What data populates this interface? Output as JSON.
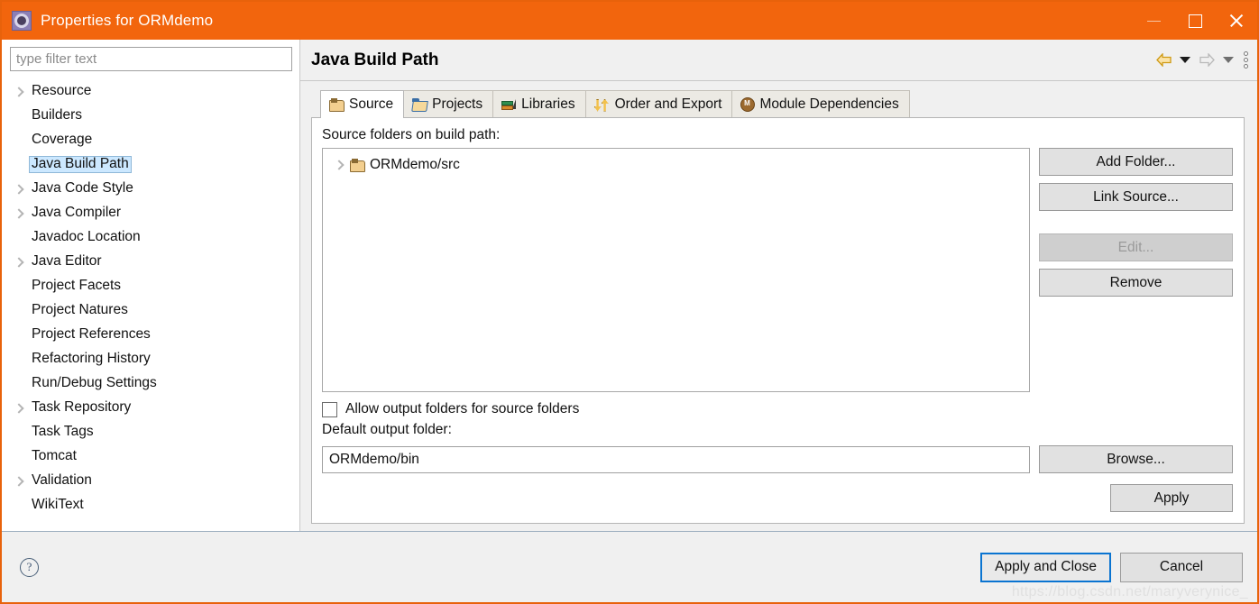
{
  "window": {
    "title": "Properties for ORMdemo",
    "icon": "gear-icon",
    "accent_color": "#f2650d",
    "controls": {
      "minimize": "minimize",
      "maximize": "maximize",
      "close": "close"
    }
  },
  "sidebar": {
    "filter": {
      "value": "",
      "placeholder": "type filter text"
    },
    "items": [
      {
        "label": "Resource",
        "expandable": true,
        "selected": false
      },
      {
        "label": "Builders",
        "expandable": false,
        "selected": false
      },
      {
        "label": "Coverage",
        "expandable": false,
        "selected": false
      },
      {
        "label": "Java Build Path",
        "expandable": false,
        "selected": true
      },
      {
        "label": "Java Code Style",
        "expandable": true,
        "selected": false
      },
      {
        "label": "Java Compiler",
        "expandable": true,
        "selected": false
      },
      {
        "label": "Javadoc Location",
        "expandable": false,
        "selected": false
      },
      {
        "label": "Java Editor",
        "expandable": true,
        "selected": false
      },
      {
        "label": "Project Facets",
        "expandable": false,
        "selected": false
      },
      {
        "label": "Project Natures",
        "expandable": false,
        "selected": false
      },
      {
        "label": "Project References",
        "expandable": false,
        "selected": false
      },
      {
        "label": "Refactoring History",
        "expandable": false,
        "selected": false
      },
      {
        "label": "Run/Debug Settings",
        "expandable": false,
        "selected": false
      },
      {
        "label": "Task Repository",
        "expandable": true,
        "selected": false
      },
      {
        "label": "Task Tags",
        "expandable": false,
        "selected": false
      },
      {
        "label": "Tomcat",
        "expandable": false,
        "selected": false
      },
      {
        "label": "Validation",
        "expandable": true,
        "selected": false
      },
      {
        "label": "WikiText",
        "expandable": false,
        "selected": false
      }
    ]
  },
  "main": {
    "title": "Java Build Path",
    "nav": {
      "back": "back-arrow",
      "back_menu": "back-dropdown",
      "forward": "forward-arrow",
      "forward_menu": "forward-dropdown",
      "menu": "view-menu"
    },
    "tabs": [
      {
        "label": "Source",
        "icon": "package-folder-icon",
        "active": true
      },
      {
        "label": "Projects",
        "icon": "open-folder-icon",
        "active": false
      },
      {
        "label": "Libraries",
        "icon": "books-icon",
        "active": false
      },
      {
        "label": "Order and Export",
        "icon": "up-down-arrows-icon",
        "active": false
      },
      {
        "label": "Module Dependencies",
        "icon": "module-circle-icon",
        "active": false
      }
    ],
    "source": {
      "list_label": "Source folders on build path:",
      "entries": [
        {
          "label": "ORMdemo/src",
          "icon": "package-folder-icon",
          "expandable": true
        }
      ],
      "buttons": [
        {
          "label": "Add Folder...",
          "disabled": false
        },
        {
          "label": "Link Source...",
          "disabled": false
        },
        {
          "label": "Edit...",
          "disabled": true
        },
        {
          "label": "Remove",
          "disabled": false
        }
      ],
      "allow_output_checkbox": {
        "label": "Allow output folders for source folders",
        "checked": false
      },
      "default_output_label": "Default output folder:",
      "default_output_value": "ORMdemo/bin",
      "browse_label": "Browse...",
      "apply_label": "Apply"
    }
  },
  "footer": {
    "help": "?",
    "apply_and_close": "Apply and Close",
    "cancel": "Cancel",
    "watermark": "https://blog.csdn.net/maryverynice_"
  }
}
